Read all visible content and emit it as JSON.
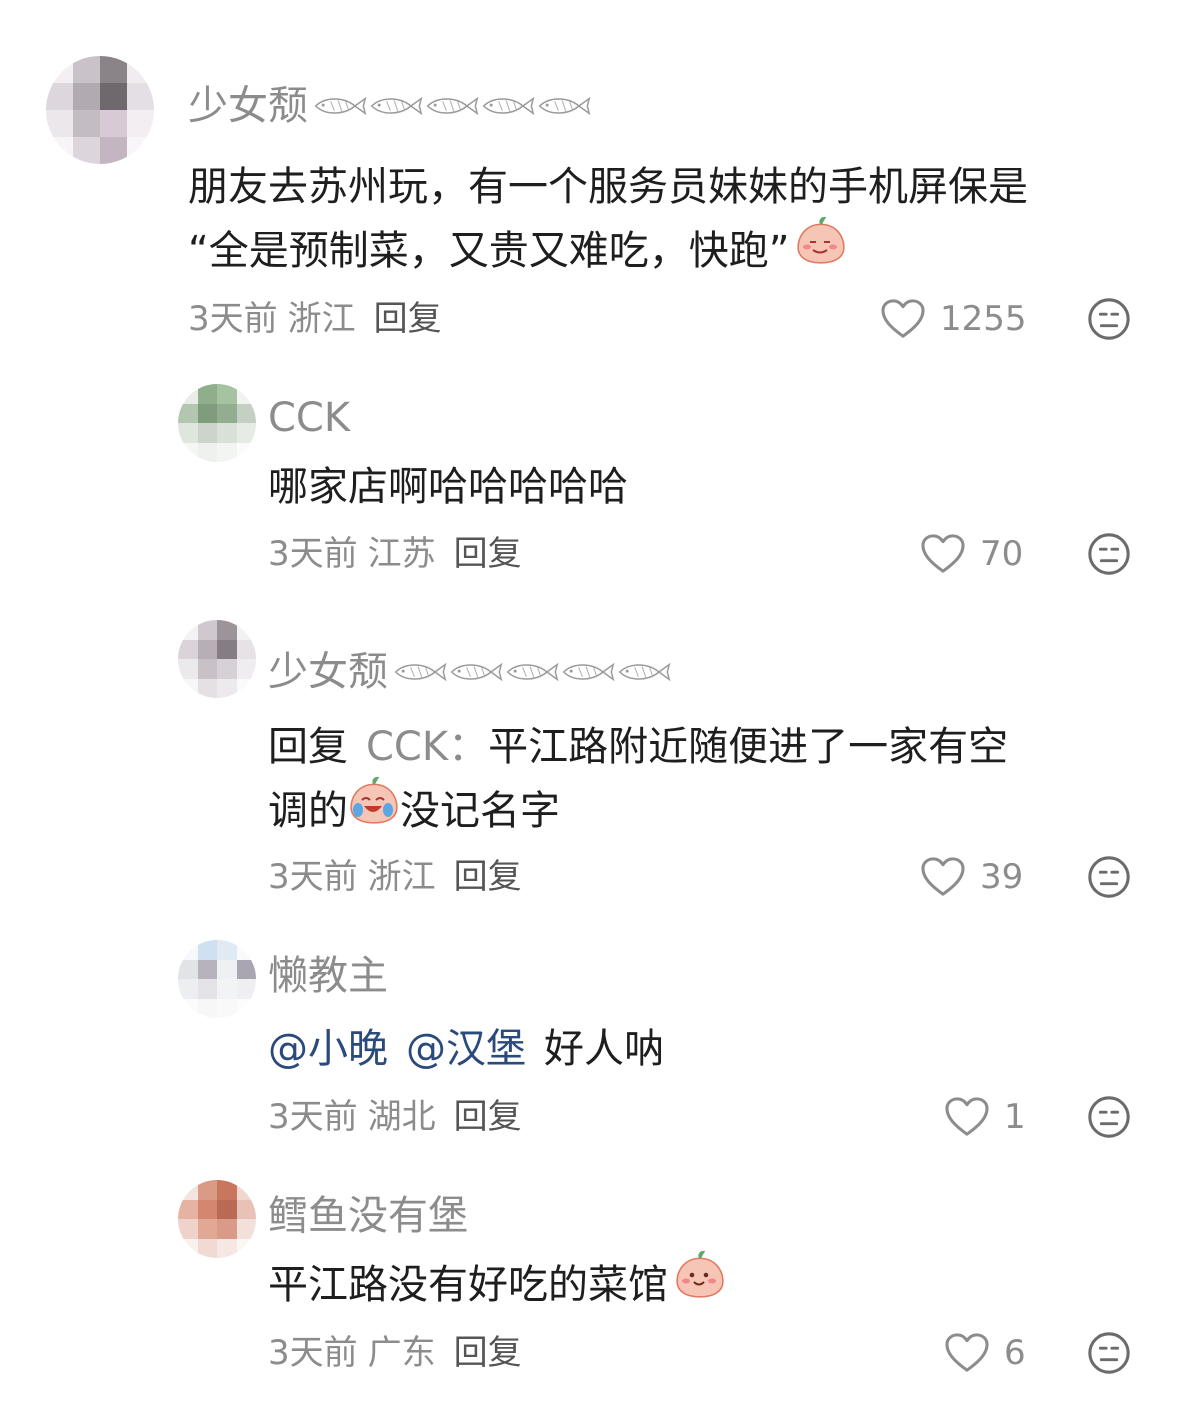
{
  "comments": [
    {
      "name": "少女颓",
      "text": "朋友去苏州玩，有一个服务员妹妹的手机屏保是",
      "text2": "“全是预制菜，又贵又难吃，快跑”",
      "time": "3天前",
      "location": "浙江",
      "reply_label": "回复",
      "likes": "1255"
    },
    {
      "name": "CCK",
      "text": "哪家店啊哈哈哈哈哈",
      "time": "3天前",
      "location": "江苏",
      "reply_label": "回复",
      "likes": "70"
    },
    {
      "name": "少女颓",
      "reply_prefix": "回复",
      "reply_target": "CCK：",
      "text": "平江路附近随便进了一家有空",
      "text2a": "调的",
      "text2b": "没记名字",
      "time": "3天前",
      "location": "浙江",
      "reply_label": "回复",
      "likes": "39"
    },
    {
      "name": "懒教主",
      "mention1": "@小晚",
      "mention2": "@汉堡",
      "text": "好人呐",
      "time": "3天前",
      "location": "湖北",
      "reply_label": "回复",
      "likes": "1"
    },
    {
      "name": "鳕鱼没有堡",
      "text": "平江路没有好吃的菜馆",
      "time": "3天前",
      "location": "广东",
      "reply_label": "回复",
      "likes": "6"
    }
  ],
  "icons": {
    "like": "heart-outline-icon",
    "dislike": "neutral-face-icon",
    "emoji1": "blushing-peach-emoji",
    "emoji2": "crying-laugh-peach-emoji",
    "emoji3": "smiling-peach-emoji",
    "decoration": "fish-decoration-icon"
  },
  "colors": {
    "name": "#8c8c8c",
    "text": "#1e1e1e",
    "mention": "#2b4a7c",
    "meta": "#8c8c8c"
  }
}
